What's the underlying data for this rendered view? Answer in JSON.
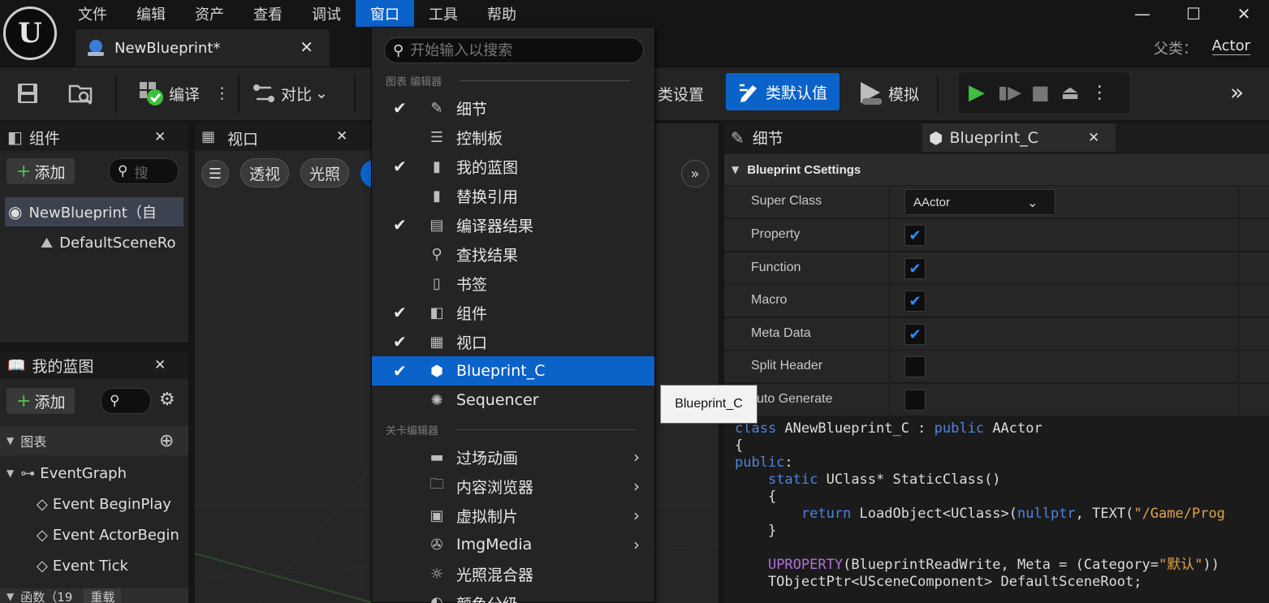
{
  "menubar": {
    "items": [
      "文件",
      "编辑",
      "资产",
      "查看",
      "调试",
      "窗口",
      "工具",
      "帮助"
    ],
    "active_index": 5
  },
  "document_tab": {
    "title": "NewBlueprint*",
    "close": "✕"
  },
  "window_controls": {
    "minimize": "—",
    "maximize": "☐",
    "close": "✕"
  },
  "parent_class": {
    "label": "父类：",
    "value": "Actor"
  },
  "toolbar": {
    "compile": "编译",
    "diff": "对比",
    "class_settings": "类设置",
    "class_defaults": "类默认值",
    "simulate": "模拟"
  },
  "components_panel": {
    "title": "组件",
    "add_label": "添加",
    "search_placeholder": "搜",
    "tree": [
      {
        "label": "NewBlueprint（自",
        "selected": true
      },
      {
        "label": "DefaultSceneRo",
        "selected": false
      }
    ]
  },
  "viewport_panel": {
    "title": "视口",
    "pills": [
      "透视",
      "光照"
    ]
  },
  "my_blueprint_panel": {
    "title": "我的蓝图",
    "add_label": "添加",
    "graphs_section": "图表",
    "event_graph": "EventGraph",
    "events": [
      "Event BeginPlay",
      "Event ActorBegin",
      "Event Tick"
    ],
    "functions_partial": "函数（19",
    "override_label": "重载"
  },
  "window_menu": {
    "search_placeholder": "开始输入以搜索",
    "sections": [
      {
        "title": "图表 编辑器",
        "items": [
          {
            "label": "细节",
            "checked": true,
            "icon": "details-icon"
          },
          {
            "label": "控制板",
            "checked": false,
            "icon": "palette-icon"
          },
          {
            "label": "我的蓝图",
            "checked": true,
            "icon": "book-icon"
          },
          {
            "label": "替换引用",
            "checked": false,
            "icon": "book-icon"
          },
          {
            "label": "编译器结果",
            "checked": true,
            "icon": "compiler-results-icon"
          },
          {
            "label": "查找结果",
            "checked": false,
            "icon": "search-icon"
          },
          {
            "label": "书签",
            "checked": false,
            "icon": "bookmark-icon"
          },
          {
            "label": "组件",
            "checked": true,
            "icon": "components-icon"
          },
          {
            "label": "视口",
            "checked": true,
            "icon": "viewport-icon"
          },
          {
            "label": "Blueprint_C",
            "checked": true,
            "icon": "blueprint-c-icon",
            "highlighted": true
          },
          {
            "label": "Sequencer",
            "checked": false,
            "icon": "sequencer-icon"
          }
        ]
      },
      {
        "title": "关卡编辑器",
        "items": [
          {
            "label": "过场动画",
            "submenu": true,
            "icon": "cinematics-icon"
          },
          {
            "label": "内容浏览器",
            "submenu": true,
            "icon": "content-browser-icon"
          },
          {
            "label": "虚拟制片",
            "submenu": true,
            "icon": "virtual-production-icon"
          },
          {
            "label": "ImgMedia",
            "submenu": true,
            "icon": "imgmedia-icon"
          },
          {
            "label": "光照混合器",
            "submenu": false,
            "icon": "light-mixer-icon"
          },
          {
            "label": "颜色分级",
            "submenu": false,
            "icon": "color-grading-icon"
          }
        ]
      }
    ]
  },
  "tooltip": {
    "text": "Blueprint_C"
  },
  "right_tabs": {
    "details": "细节",
    "blueprint_c": "Blueprint_C"
  },
  "settings": {
    "section_title": "Blueprint CSettings",
    "super_class_label": "Super Class",
    "super_class_value": "AActor",
    "rows": [
      {
        "label": "Property",
        "checked": true
      },
      {
        "label": "Function",
        "checked": true
      },
      {
        "label": "Macro",
        "checked": true
      },
      {
        "label": "Meta Data",
        "checked": true
      },
      {
        "label": "Split Header",
        "checked": false
      },
      {
        "label": "uto Generate",
        "checked": false
      }
    ]
  },
  "code": {
    "lines": [
      "class ANewBlueprint_C : public AActor",
      "{",
      "public:",
      "    static UClass* StaticClass()",
      "    {",
      "        return LoadObject<UClass>(nullptr, TEXT(\"/Game/Prog",
      "    }",
      "",
      "    UPROPERTY(BlueprintReadWrite, Meta = (Category=\"默认\"))",
      "    TObjectPtr<USceneComponent> DefaultSceneRoot;"
    ]
  },
  "colors": {
    "accent": "#0b62c8",
    "play_green": "#3fbf3f",
    "check_blue": "#2b8cff"
  }
}
